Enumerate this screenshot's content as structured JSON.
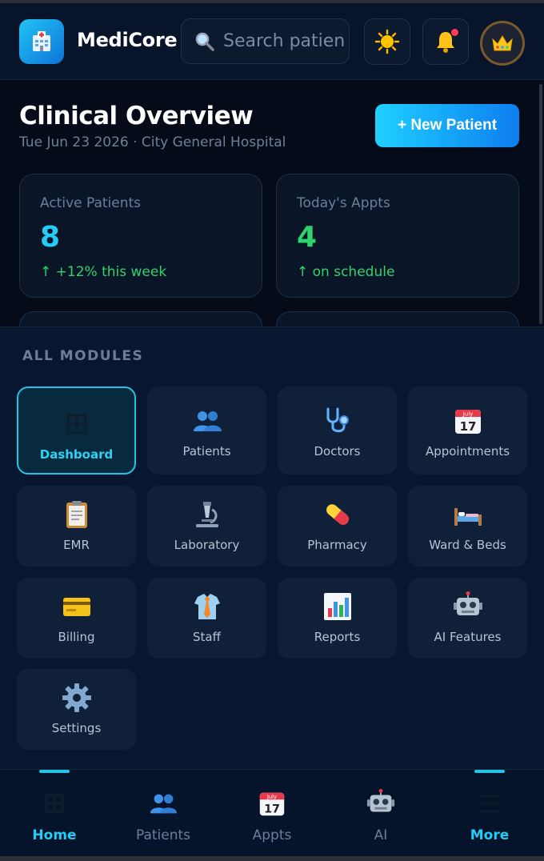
{
  "app": {
    "brand": "MediCore",
    "search_placeholder": "Search patien",
    "icons": {
      "logo": "hospital-icon",
      "search": "search-icon",
      "theme": "sun-icon",
      "notifications": "bell-icon",
      "avatar": "crown-icon"
    },
    "colors": {
      "accent": "#23cdf5",
      "success": "#2fd36b",
      "notification_dot": "#ff3b55"
    }
  },
  "overview": {
    "title": "Clinical Overview",
    "subtitle": "Tue Jun 23 2026 · City General Hospital",
    "new_button": "+ New Patient",
    "stats": [
      {
        "label": "Active Patients",
        "value": "8",
        "delta": "↑ +12% this week"
      },
      {
        "label": "Today's Appts",
        "value": "4",
        "delta": "↑ on schedule"
      }
    ]
  },
  "modules": {
    "title": "ALL MODULES",
    "items": [
      {
        "label": "Dashboard",
        "icon": "grid-icon",
        "active": true
      },
      {
        "label": "Patients",
        "icon": "people-icon"
      },
      {
        "label": "Doctors",
        "icon": "stethoscope-icon"
      },
      {
        "label": "Appointments",
        "icon": "calendar-icon"
      },
      {
        "label": "EMR",
        "icon": "clipboard-icon"
      },
      {
        "label": "Laboratory",
        "icon": "microscope-icon"
      },
      {
        "label": "Pharmacy",
        "icon": "pill-icon"
      },
      {
        "label": "Ward & Beds",
        "icon": "bed-icon"
      },
      {
        "label": "Billing",
        "icon": "credit-card-icon"
      },
      {
        "label": "Staff",
        "icon": "shirt-tie-icon"
      },
      {
        "label": "Reports",
        "icon": "bar-chart-icon"
      },
      {
        "label": "AI Features",
        "icon": "robot-icon"
      },
      {
        "label": "Settings",
        "icon": "gear-icon"
      }
    ],
    "calendar_month": "July",
    "calendar_day": "17"
  },
  "nav": {
    "items": [
      {
        "label": "Home",
        "icon": "grid-icon",
        "active": true
      },
      {
        "label": "Patients",
        "icon": "people-icon"
      },
      {
        "label": "Appts",
        "icon": "calendar-icon"
      },
      {
        "label": "AI",
        "icon": "robot-icon"
      },
      {
        "label": "More",
        "icon": "menu-icon",
        "active": true
      }
    ]
  }
}
